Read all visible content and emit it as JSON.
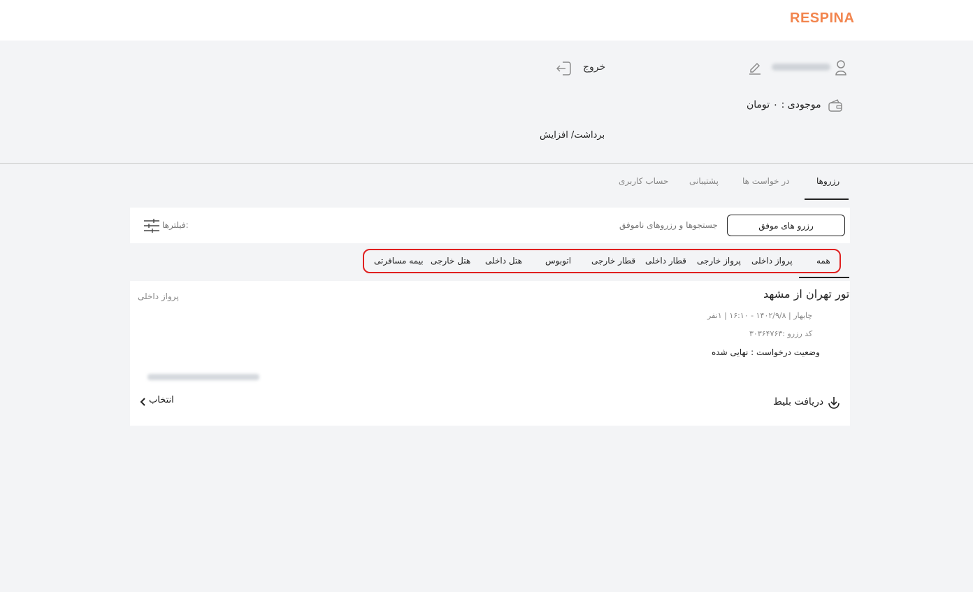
{
  "brand": {
    "name": "RESPINA"
  },
  "profile": {
    "logout_label": "خروج",
    "balance_text": "موجودی :  ۰ تومان",
    "withdraw_label": "برداشت/ افزایش"
  },
  "tabs": [
    {
      "label": "رزروها"
    },
    {
      "label": "در خواست ها"
    },
    {
      "label": "پشتیبانی"
    },
    {
      "label": "حساب کاربری"
    }
  ],
  "filterbar": {
    "success_label": "رزرو های موفق",
    "failed_label": "جستجوها و رزروهای ناموفق",
    "filters_label": "فیلترها:"
  },
  "categories": [
    {
      "label": "همه"
    },
    {
      "label": "پرواز داخلی"
    },
    {
      "label": "پرواز خارجی"
    },
    {
      "label": "قطار داخلی"
    },
    {
      "label": "قطار خارجی"
    },
    {
      "label": "اتوبوس"
    },
    {
      "label": "هتل داخلی"
    },
    {
      "label": "هتل خارجی"
    },
    {
      "label": "بیمه مسافرتی"
    }
  ],
  "reservation": {
    "title": "تور تهران از مشهد",
    "type": "پرواز داخلی",
    "date_line": "چابهار | ۱۴۰۲/۹/۸ - ۱۶:۱۰ | ۱نفر",
    "code_line": "کد رزرو :۳۰۳۶۴۷۶۳",
    "status_line": "وضعیت درخواست : نهایی شده",
    "ticket_label": "دریافت بلیط",
    "select_label": "انتخاب"
  },
  "colors": {
    "brand": "#f2854e",
    "highlight": "#e02020"
  }
}
